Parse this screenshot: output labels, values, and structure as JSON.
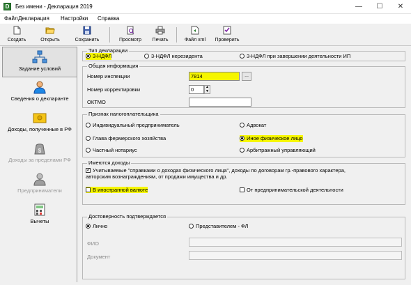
{
  "window": {
    "title": "Без имени - Декларация 2019",
    "minimize": "—",
    "maximize": "☐",
    "close": "✕"
  },
  "menu": [
    "Файл",
    "Декларация",
    "Настройки",
    "Справка"
  ],
  "toolbar": {
    "create": "Создать",
    "open": "Открыть",
    "save": "Сохранить",
    "preview": "Просмотр",
    "print": "Печать",
    "xml": "Файл xml",
    "check": "Проверить"
  },
  "sidebar": [
    {
      "label": "Задание условий",
      "icon": "conditions-icon",
      "state": "active"
    },
    {
      "label": "Сведения о декларанте",
      "icon": "declarant-icon",
      "state": "normal"
    },
    {
      "label": "Доходы, полученные в РФ",
      "icon": "income-rf-icon",
      "state": "normal"
    },
    {
      "label": "Доходы за пределами РФ",
      "icon": "foreign-income-icon",
      "state": "disabled"
    },
    {
      "label": "Предприниматели",
      "icon": "entrepreneur-icon",
      "state": "disabled"
    },
    {
      "label": "Вычеты",
      "icon": "deductions-icon",
      "state": "normal"
    }
  ],
  "decl_type": {
    "title": "Тип декларации",
    "options": [
      "3-НДФЛ",
      "3-НДФЛ нерезидента",
      "3-НДФЛ при завершении деятельности ИП"
    ],
    "selected": "3-НДФЛ"
  },
  "general": {
    "title": "Общая информация",
    "inspection_label": "Номер инспекции",
    "inspection_value": "7814",
    "browse_label": "...",
    "correction_label": "Номер корректировки",
    "correction_value": "0",
    "oktmo_label": "ОКТМО",
    "oktmo_value": ""
  },
  "taxpayer": {
    "title": "Признак налогоплательщика",
    "options": [
      "Индивидуальный предприниматель",
      "Адвокат",
      "Глава фермерского хозяйства",
      "Иное физическое лицо",
      "Частный нотариус",
      "Арбитражный управляющий"
    ],
    "selected": "Иное физическое лицо"
  },
  "income": {
    "title": "Имеются доходы",
    "help_ref": "Учитываемые \"справками о доходах физического лица\", доходы по договорам гр.-правового характера, авторским вознаграждениям, от продажи имущества и др.",
    "help_ref_checked": true,
    "foreign_currency": "В иностранной валюте",
    "foreign_currency_checked": false,
    "business": "От предпринимательской деятельности",
    "business_checked": false
  },
  "authenticity": {
    "title": "Достоверность подтверждается",
    "options": [
      "Лично",
      "Представителем - ФЛ"
    ],
    "selected": "Лично",
    "fio_label": "ФИО",
    "document_label": "Документ"
  },
  "colors": {
    "highlight": "#f6f600",
    "window_bg": "#f0f0f0",
    "accent": "#2e7d32"
  }
}
